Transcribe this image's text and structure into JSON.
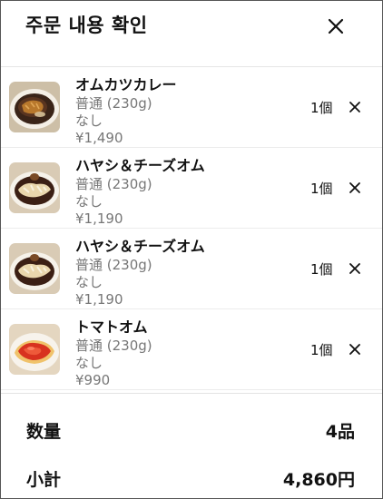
{
  "header": {
    "title": "주문 내용 확인",
    "close_icon": "close-icon"
  },
  "items": [
    {
      "name": "オムカツカレー",
      "size": "普通 (230g)",
      "option": "なし",
      "price": "¥1,490",
      "qty": "1個",
      "image": "omucutlet-curry-photo"
    },
    {
      "name": "ハヤシ＆チーズオム",
      "size": "普通 (230g)",
      "option": "なし",
      "price": "¥1,190",
      "qty": "1個",
      "image": "hayashi-cheese-omu-photo"
    },
    {
      "name": "ハヤシ＆チーズオム",
      "size": "普通 (230g)",
      "option": "なし",
      "price": "¥1,190",
      "qty": "1個",
      "image": "hayashi-cheese-omu-photo"
    },
    {
      "name": "トマトオム",
      "size": "普通 (230g)",
      "option": "なし",
      "price": "¥990",
      "qty": "1個",
      "image": "tomato-omu-photo"
    }
  ],
  "summary": {
    "quantity_label": "数量",
    "quantity_value": "4品",
    "subtotal_label": "小計",
    "subtotal_value": "4,860円"
  },
  "colors": {
    "text": "#111111",
    "muted": "#777777",
    "divider": "#e6e6e6"
  }
}
